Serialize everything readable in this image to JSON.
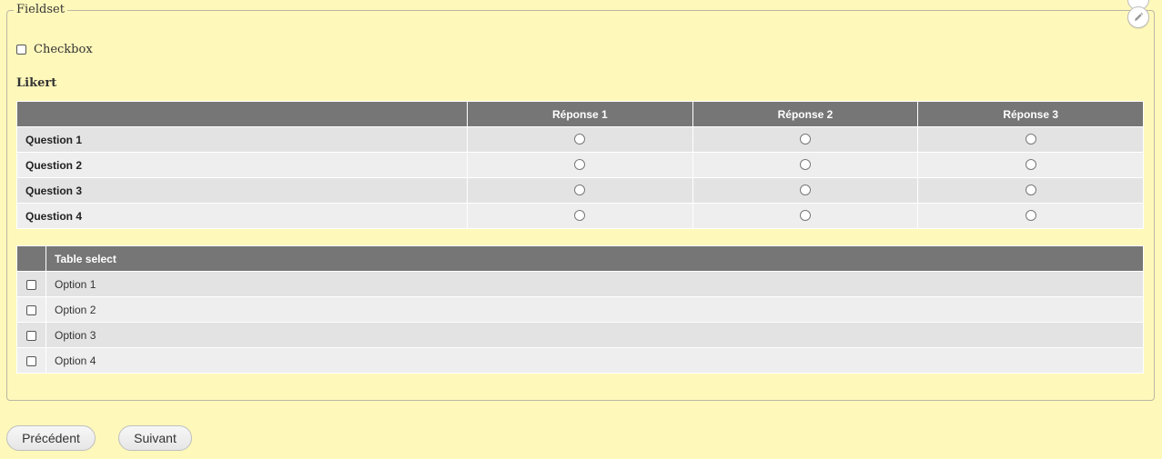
{
  "fieldset": {
    "legend": "Fieldset"
  },
  "checkbox": {
    "label": "Checkbox",
    "checked": false
  },
  "likert": {
    "title": "Likert",
    "columns": [
      "Réponse 1",
      "Réponse 2",
      "Réponse 3"
    ],
    "rows": [
      "Question 1",
      "Question 2",
      "Question 3",
      "Question 4"
    ]
  },
  "table_select": {
    "header": "Table select",
    "options": [
      "Option 1",
      "Option 2",
      "Option 3",
      "Option 4"
    ]
  },
  "nav": {
    "previous_label": "Précédent",
    "next_label": "Suivant"
  },
  "icons": {
    "edit": "pencil-icon"
  },
  "colors": {
    "background": "#fff8bb",
    "header": "#767676",
    "row_odd": "#e3e3e3",
    "row_even": "#eeeeee"
  }
}
